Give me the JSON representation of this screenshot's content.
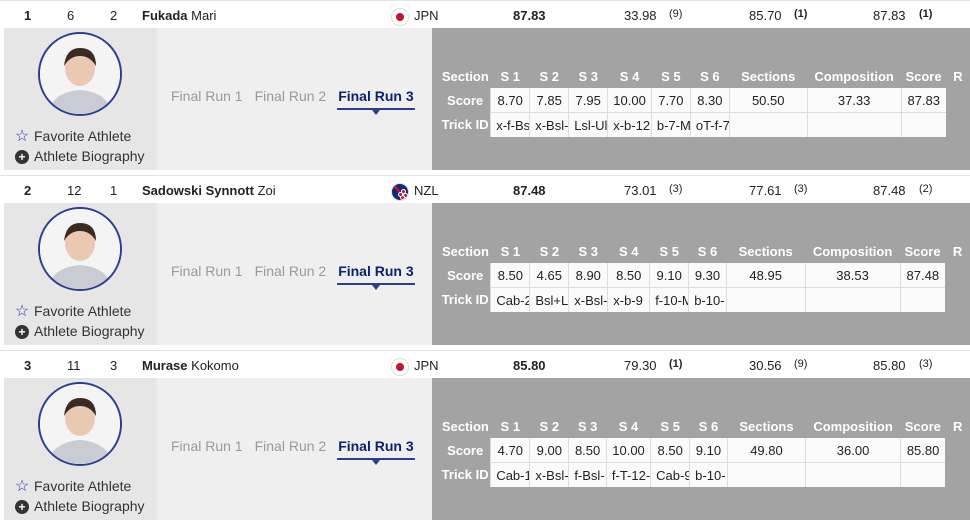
{
  "table_headers": [
    "Section",
    "S 1",
    "S 2",
    "S 3",
    "S 4",
    "S 5",
    "S 6",
    "Sections",
    "Composition",
    "Score",
    "R"
  ],
  "row_labels": {
    "score": "Score",
    "trick": "Trick ID"
  },
  "card_links": {
    "favorite": "Favorite Athlete",
    "bio": "Athlete Biography"
  },
  "run_tabs": [
    "Final Run 1",
    "Final Run 2",
    "Final Run 3"
  ],
  "active_run": "Final Run 3",
  "athletes": [
    {
      "rank": "1",
      "col2": "6",
      "col3": "2",
      "last": "Fukada",
      "first": "Mari",
      "country": "JPN",
      "flag": "jpn",
      "total": "87.83",
      "run_a": "33.98",
      "run_a_rank": "(9)",
      "run_b": "85.70",
      "run_b_rank": "(1)",
      "run_b_bold": true,
      "run_c": "87.83",
      "run_c_rank": "(1)",
      "run_c_bold": true,
      "scores": [
        "8.70",
        "7.85",
        "7.95",
        "10.00",
        "7.70",
        "8.30",
        "50.50",
        "37.33",
        "87.83"
      ],
      "tricks": [
        "x-f-Bs",
        "x-Bsl-",
        "Lsl-Ul",
        "x-b-12",
        "b-7-M",
        "oT-f-7",
        "",
        "",
        ""
      ]
    },
    {
      "rank": "2",
      "col2": "12",
      "col3": "1",
      "last": "Sadowski Synnott",
      "first": "Zoi",
      "country": "NZL",
      "flag": "nzl",
      "total": "87.48",
      "run_a": "73.01",
      "run_a_rank": "(3)",
      "run_b": "77.61",
      "run_b_rank": "(3)",
      "run_b_bold": false,
      "run_c": "87.48",
      "run_c_rank": "(2)",
      "run_c_bold": false,
      "scores": [
        "8.50",
        "4.65",
        "8.90",
        "8.50",
        "9.10",
        "9.30",
        "48.95",
        "38.53",
        "87.48"
      ],
      "tricks": [
        "Cab-2",
        "Bsl+L",
        "x-Bsl-",
        "x-b-9",
        "f-10-M",
        "b-10-",
        "",
        "",
        ""
      ]
    },
    {
      "rank": "3",
      "col2": "11",
      "col3": "3",
      "last": "Murase",
      "first": "Kokomo",
      "country": "JPN",
      "flag": "jpn",
      "total": "85.80",
      "run_a": "79.30",
      "run_a_rank": "(1)",
      "run_a_bold": true,
      "run_b": "30.56",
      "run_b_rank": "(9)",
      "run_b_bold": false,
      "run_c": "85.80",
      "run_c_rank": "(3)",
      "run_c_bold": false,
      "scores": [
        "4.70",
        "9.00",
        "8.50",
        "10.00",
        "8.50",
        "9.10",
        "49.80",
        "36.00",
        "85.80"
      ],
      "tricks": [
        "Cab-1",
        "x-Bsl-",
        "f-Bsl-",
        "f-T-12-",
        "Cab-9",
        "b-10-",
        "",
        "",
        ""
      ]
    }
  ],
  "colors": {
    "accent": "#2b3f8f",
    "panel": "#a3a3a3",
    "card": "#e6e6e6"
  }
}
